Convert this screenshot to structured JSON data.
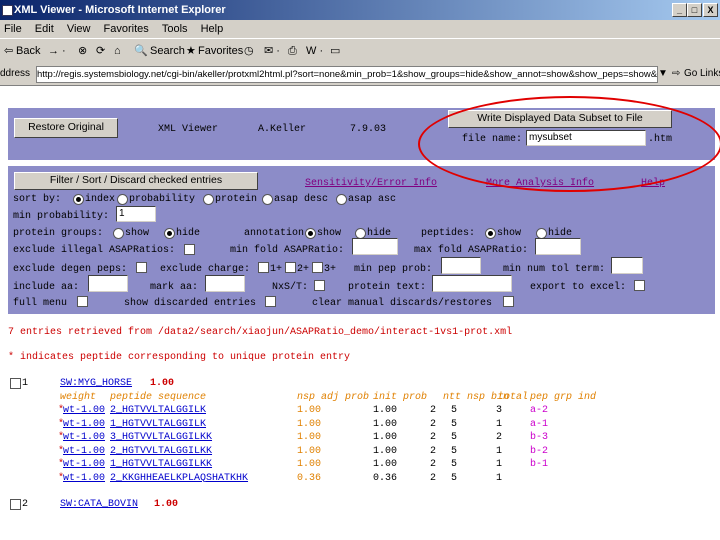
{
  "window": {
    "title": "XML Viewer - Microsoft Internet Explorer",
    "min": "_",
    "max": "□",
    "close": "X"
  },
  "menu": [
    "File",
    "Edit",
    "View",
    "Favorites",
    "Tools",
    "Help"
  ],
  "toolbar": {
    "back": "Back",
    "search": "Search",
    "favorites": "Favorites"
  },
  "address": {
    "label": "ddress",
    "url": "http://regis.systemsbiology.net/cgi-bin/akeller/protxml2html.pl?sort=none&min_prob=1&show_groups=hide&show_annot=show&show_peps=show&min_asap=&m",
    "go": "Go",
    "links": "Links"
  },
  "header": {
    "restore_button": "Restore Original",
    "app": "XML Viewer",
    "author": "A.Keller",
    "version": "7.9.03",
    "write_button": "Write Displayed Data Subset to File",
    "file_label": "file name:",
    "file_value": "mysubset",
    "file_ext": ".htm"
  },
  "filter": {
    "button": "Filter / Sort / Discard checked entries",
    "links": {
      "sensitivity": "Sensitivity/Error Info",
      "analysis": "More Analysis Info",
      "help": "Help"
    },
    "sort_by": "sort by:",
    "sort_opts": [
      "index",
      "probability",
      "protein",
      "asap desc",
      "asap asc"
    ],
    "min_probability": "min probability:",
    "min_probability_value": "1",
    "protein_groups": "protein groups:",
    "annotation": "annotation:",
    "peptides": "peptides:",
    "show": "show",
    "hide": "hide",
    "exclude_illegal": "exclude illegal ASAPRatios:",
    "min_fold": "min fold ASAPRatio:",
    "max_fold": "max fold ASAPRatio:",
    "exclude_degen": "exclude degen peps:",
    "exclude_charge": "exclude charge:",
    "c1": "1+",
    "c2": "2+",
    "c3": "3+",
    "min_pep_prob": "min pep prob:",
    "min_num_tol": "min num tol term:",
    "include_aa": "include aa:",
    "mark_aa": "mark aa:",
    "nxst": "NxS/T:",
    "protein_text": "protein text:",
    "export_excel": "export to excel:",
    "full_menu": "full menu",
    "show_discarded": "show discarded entries",
    "clear_manual": "clear manual discards/restores"
  },
  "results": {
    "retrieved": "7 entries retrieved from /data2/search/xiaojun/ASAPRatio_demo/interact-1vs1-prot.xml",
    "note": "* indicates peptide corresponding to unique protein entry",
    "entry1": {
      "index": "1",
      "protein": "SW:MYG_HORSE",
      "prob": "1.00"
    },
    "columns": [
      "weight",
      "peptide sequence",
      "nsp adj prob",
      "init prob",
      "ntt",
      "nsp bin",
      "total",
      "pep grp ind"
    ],
    "rows": [
      {
        "weight": "wt-1.00",
        "seq": "2_HGTVVLTALGGILK",
        "nsp": "1.00",
        "init": "1.00",
        "ntt": "2",
        "bin": "5",
        "total": "3",
        "grp": "a-2"
      },
      {
        "weight": "wt-1.00",
        "seq": "1_HGTVVLTALGGILK",
        "nsp": "1.00",
        "init": "1.00",
        "ntt": "2",
        "bin": "5",
        "total": "1",
        "grp": "a-1"
      },
      {
        "weight": "wt-1.00",
        "seq": "3_HGTVVLTALGGILKK",
        "nsp": "1.00",
        "init": "1.00",
        "ntt": "2",
        "bin": "5",
        "total": "2",
        "grp": "b-3"
      },
      {
        "weight": "wt-1.00",
        "seq": "2_HGTVVLTALGGILKK",
        "nsp": "1.00",
        "init": "1.00",
        "ntt": "2",
        "bin": "5",
        "total": "1",
        "grp": "b-2"
      },
      {
        "weight": "wt-1.00",
        "seq": "1_HGTVVLTALGGILKK",
        "nsp": "1.00",
        "init": "1.00",
        "ntt": "2",
        "bin": "5",
        "total": "1",
        "grp": "b-1"
      },
      {
        "weight": "wt-1.00",
        "seq": "2_KKGHHEAELKPLAQSHATKHK",
        "nsp": "0.36",
        "init": "0.36",
        "ntt": "2",
        "bin": "5",
        "total": "1",
        "grp": ""
      }
    ],
    "entry2": {
      "index": "2",
      "protein": "SW:CATA_BOVIN",
      "prob": "1.00"
    }
  }
}
